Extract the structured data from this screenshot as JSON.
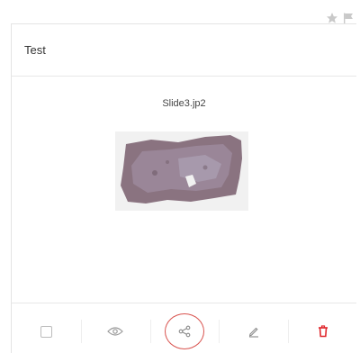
{
  "card": {
    "title": "Test",
    "filename": "Slide3.jp2"
  },
  "icons": {
    "corner": [
      "star-icon",
      "flag-icon"
    ],
    "toolbar": [
      "checkbox",
      "eye-icon",
      "share-icon",
      "pencil-icon",
      "trash-icon"
    ]
  },
  "colors": {
    "highlight_ring": "#d9534f",
    "delete": "#e0262b",
    "icon_gray": "#9a9a9a",
    "tissue": "#8a7380"
  }
}
